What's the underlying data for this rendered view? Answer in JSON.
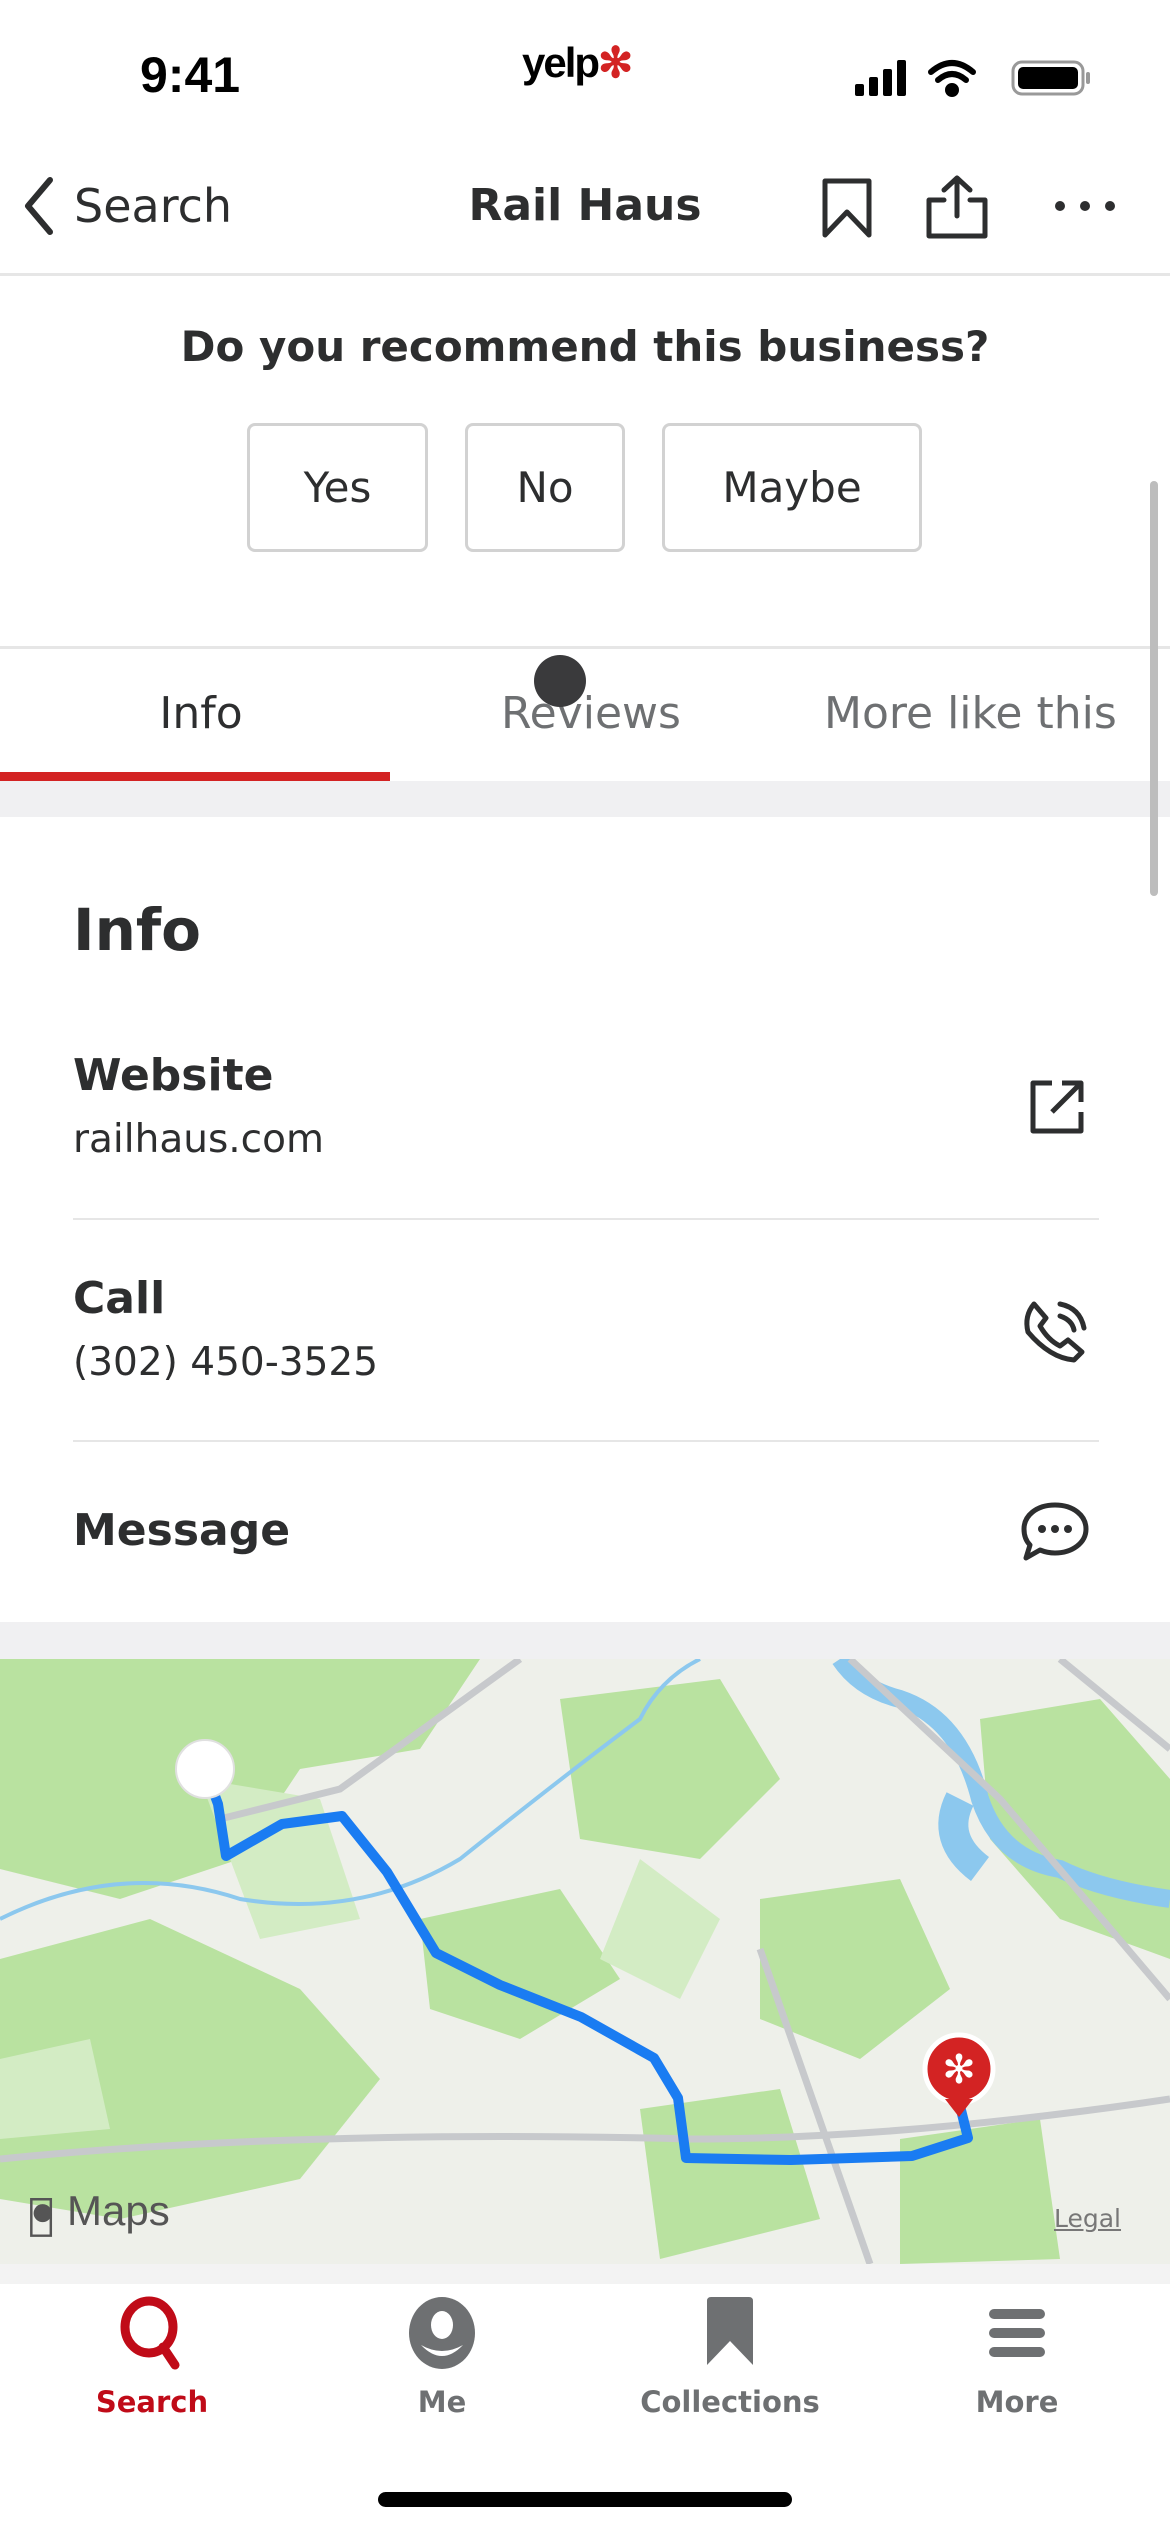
{
  "status": {
    "time": "9:41",
    "logo": "yelp"
  },
  "nav": {
    "back_label": "Search",
    "title": "Rail Haus"
  },
  "recommend": {
    "question": "Do you recommend this business?",
    "options": [
      "Yes",
      "No",
      "Maybe"
    ]
  },
  "tabs": [
    {
      "label": "Info",
      "active": true
    },
    {
      "label": "Reviews"
    },
    {
      "label": "More like this"
    }
  ],
  "info": {
    "heading": "Info",
    "website_label": "Website",
    "website_value": "railhaus.com",
    "call_label": "Call",
    "call_value": "(302) 450-3525",
    "message_label": "Message"
  },
  "map": {
    "attribution": "Maps",
    "legal": "Legal"
  },
  "tabbar": [
    {
      "label": "Search",
      "active": true
    },
    {
      "label": "Me"
    },
    {
      "label": "Collections"
    },
    {
      "label": "More"
    }
  ],
  "colors": {
    "accent": "#d32323",
    "route": "#1a7cf2",
    "inactive": "#6e7072"
  }
}
